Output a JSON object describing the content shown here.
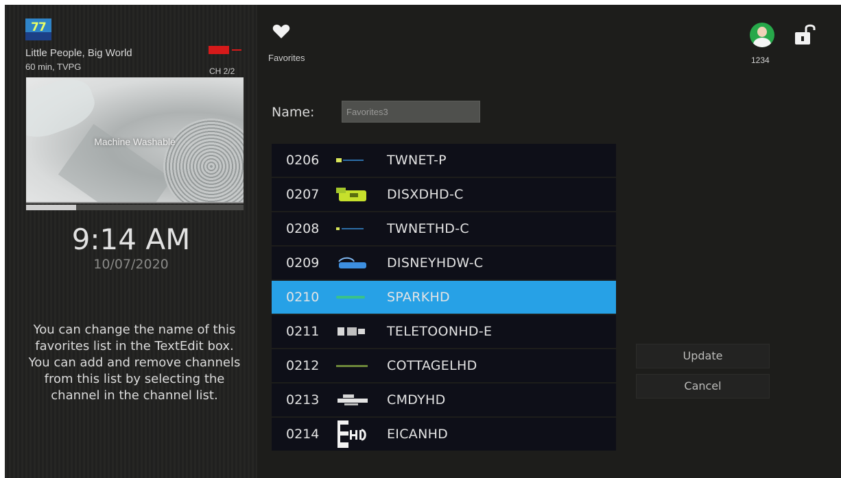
{
  "now_playing": {
    "title": "Little People, Big World",
    "meta": "60 min, TVPG",
    "channel": "CH 2/2",
    "preview_caption": "Machine Washable",
    "progress": 0.23,
    "logo_text": "77"
  },
  "clock": {
    "time": "9:14 AM",
    "date": "10/07/2020"
  },
  "help": {
    "text": "You can change the name of this favorites list in the TextEdit box. You can add and remove channels from this list by selecting the channel in the channel list."
  },
  "header": {
    "favorites_label": "Favorites",
    "user_id": "1234"
  },
  "name_field": {
    "label": "Name:",
    "value": "Favorites3"
  },
  "channels": [
    {
      "number": "0206",
      "name": "TWNET-P",
      "logo": "twnet-logo",
      "selected": false
    },
    {
      "number": "0207",
      "name": "DISXDHD-C",
      "logo": "disney-xd-logo",
      "selected": false
    },
    {
      "number": "0208",
      "name": "TWNETHD-C",
      "logo": "twnet-hd-logo",
      "selected": false
    },
    {
      "number": "0209",
      "name": "DISNEYHDW-C",
      "logo": "disney-logo",
      "selected": false
    },
    {
      "number": "0210",
      "name": "SPARKHD",
      "logo": "spark-logo",
      "selected": true
    },
    {
      "number": "0211",
      "name": "TELETOONHD-E",
      "logo": "teletoon-logo",
      "selected": false
    },
    {
      "number": "0212",
      "name": "COTTAGELHD",
      "logo": "cottage-life-logo",
      "selected": false
    },
    {
      "number": "0213",
      "name": "CMDYHD",
      "logo": "comedy-logo",
      "selected": false
    },
    {
      "number": "0214",
      "name": "EICANHD",
      "logo": "e-hd-logo",
      "selected": false
    }
  ],
  "buttons": {
    "update": "Update",
    "cancel": "Cancel"
  },
  "colors": {
    "selected_row": "#27a1e6",
    "row_bg": "#0e0f18",
    "avatar": "#27a84a",
    "rec_badge": "#d61a1a"
  }
}
